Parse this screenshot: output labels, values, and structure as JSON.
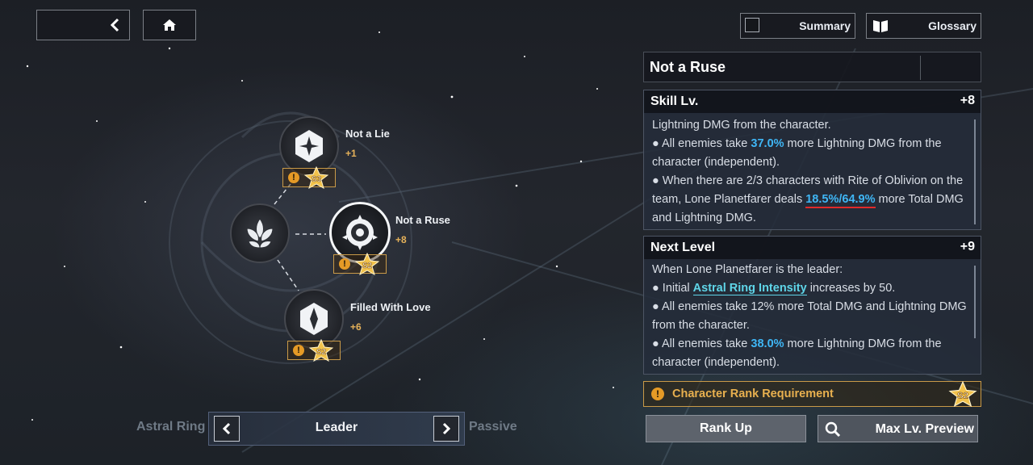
{
  "top_left": {
    "back_icon": "chevron-left-icon",
    "home_icon": "home-icon"
  },
  "top_right": {
    "summary_label": "Summary",
    "glossary_label": "Glossary",
    "glossary_icon": "book-icon"
  },
  "tree": {
    "nodes": [
      {
        "name": "Not a Lie",
        "plus": "+1",
        "rank": "S3"
      },
      {
        "name": "Not a Ruse",
        "plus": "+8",
        "rank": "S2"
      },
      {
        "name": "Filled With Love",
        "plus": "+6",
        "rank": "S2"
      }
    ],
    "warn_glyph": "!"
  },
  "bottom_nav": {
    "left": "Astral Ring",
    "center": "Leader",
    "right": "Passive"
  },
  "panel": {
    "title": "Not a Ruse",
    "skill": {
      "heading": "Skill Lv.",
      "level": "+8",
      "line1": "Lightning DMG from the character.",
      "b1_pre": "● All enemies take ",
      "b1_val": "37.0%",
      "b1_post": " more Lightning DMG from the character (independent).",
      "b2_pre": "● When there are 2/3 characters with Rite of Oblivion on the team, Lone Planetfarer deals ",
      "b2_val": "18.5%/64.9%",
      "b2_post": " more Total DMG and Lightning DMG."
    },
    "next": {
      "heading": "Next Level",
      "level": "+9",
      "line1": "When Lone Planetfarer is the leader:",
      "b1_pre": "● Initial ",
      "b1_link": "Astral Ring Intensity",
      "b1_post": " increases by 50.",
      "b2": "● All enemies take 12% more Total DMG and Lightning DMG from the character.",
      "b3_pre": "● All enemies take ",
      "b3_val": "38.0%",
      "b3_post": " more Lightning DMG from the character (independent)."
    },
    "requirement": {
      "label": "Character Rank Requirement",
      "rank": "S2"
    },
    "rank_up_label": "Rank Up",
    "max_preview_label": "Max Lv. Preview",
    "search_icon": "search-icon"
  },
  "colors": {
    "accent_gold": "#e8b04f",
    "accent_blue": "#3fb6f5",
    "link_teal": "#5fd5e8",
    "underline_red": "#e02a2a"
  }
}
